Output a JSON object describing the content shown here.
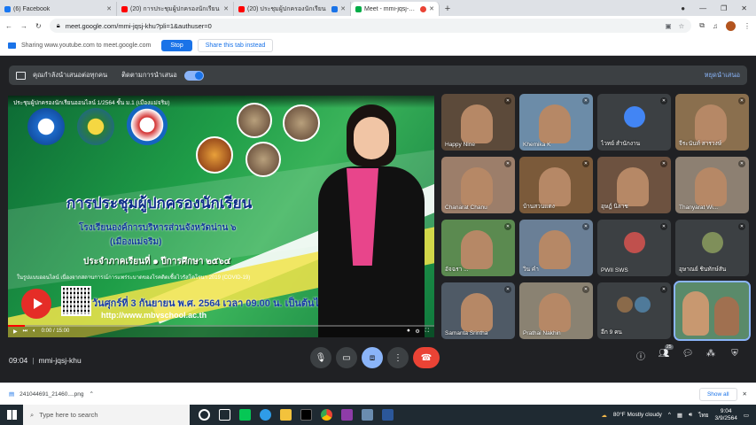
{
  "tabs": [
    {
      "label": "(6) Facebook",
      "color": "#1877f2"
    },
    {
      "label": "(20) การประชุมผู้ปกครองนักเรียน",
      "color": "#ff0000"
    },
    {
      "label": "(20) ประชุมผู้ปกครองนักเรียน",
      "color": "#ff0000"
    },
    {
      "label": "Meet - mmi-jqsj-khu",
      "color": "#00ac47",
      "active": true
    }
  ],
  "address": {
    "url": "meet.google.com/mmi-jqsj-khu?pli=1&authuser=0"
  },
  "share_bar": {
    "text": "Sharing www.youtube.com to meet.google.com",
    "stop_label": "Stop",
    "share_tab_label": "Share this tab instead"
  },
  "presentation_bar": {
    "title": "คุณกำลังนำเสนอต่อทุกคน",
    "follow_label": "ติดตามการนำเสนอ",
    "stop_label": "หยุดนำเสนอ"
  },
  "stage": {
    "top_caption": "ประชุมผู้ปกครองนักเรียนออนไลน์ 1/2564 ชั้น ม.1 (เมืองแม่จริม)",
    "title": "การประชุมผู้ปกครองนักเรียน",
    "line1": "โรงเรียนองค์การบริหารส่วนจังหวัดน่าน ๖",
    "line2": "(เมืองแม่จริม)",
    "line3": "ประจำภาคเรียนที่ ๑ ปีการศึกษา ๒๕๖๔",
    "line4": "ในรูปแบบออนไลน์ เนื่องจากสถานการณ์การแพร่ระบาดของโรคติดเชื้อไวรัสโคโรนา 2019 (COVID-19)",
    "date_line": "วันศุกร์ที่ 3 กันยายน พ.ศ. 2564 เวลา 09.00 น. เป็นต้นไป",
    "url_line": "http://www.mbvschool.ac.th",
    "video_time": "0:00 / 15:00",
    "progress": 0.04
  },
  "participants": [
    {
      "name": "Happy Nine",
      "type": "cam",
      "bg": "#5c4a3a"
    },
    {
      "name": "Khemika K",
      "type": "cam",
      "bg": "#6c8ca8"
    },
    {
      "name": "ไวทย์ สำนักงาน",
      "type": "avatar",
      "bg": "#3c4043",
      "ava": "#4285f4"
    },
    {
      "name": "จีระนันท์ สารวงษ์",
      "type": "cam",
      "bg": "#8a6f4e"
    },
    {
      "name": "Chanarat Chanu",
      "type": "cam",
      "bg": "#9c7e6a"
    },
    {
      "name": "บ้านสวนแดง",
      "type": "cam",
      "bg": "#7b5a3a"
    },
    {
      "name": "อุษฎ์ นิลาช",
      "type": "cam",
      "bg": "#6d5240"
    },
    {
      "name": "Thanyarat Wi...",
      "type": "cam",
      "bg": "#8d8072"
    },
    {
      "name": "อัจฉรา ...",
      "type": "cam",
      "bg": "#5b8a50"
    },
    {
      "name": "วิน คำ",
      "type": "cam",
      "bg": "#6a7f96"
    },
    {
      "name": "PWII SWS",
      "type": "avatar",
      "bg": "#3c4043",
      "ava": "#c0504d"
    },
    {
      "name": "อุษาณย์ ชินทักษ์สัน",
      "type": "avatar",
      "bg": "#3c4043",
      "ava": "#7f8f5a"
    },
    {
      "name": "Samanta Srintha",
      "type": "cam",
      "bg": "#4f5a66"
    },
    {
      "name": "Prathai Nakhin",
      "type": "cam",
      "bg": "#8a8272"
    },
    {
      "name": "อีก 9 คน",
      "type": "more",
      "bg": "#3c4043"
    },
    {
      "name": "",
      "type": "self",
      "bg": "#5a8a6a"
    }
  ],
  "meeting": {
    "time": "09:04",
    "code": "mmi-jqsj-khu",
    "participant_count": "25"
  },
  "download": {
    "filename": "241044691_21460....png",
    "show_all": "Show all"
  },
  "taskbar": {
    "search_placeholder": "Type here to search",
    "weather": "80°F  Mostly cloudy",
    "lang": "ไทย",
    "time": "9:04",
    "date": "3/9/2564"
  }
}
